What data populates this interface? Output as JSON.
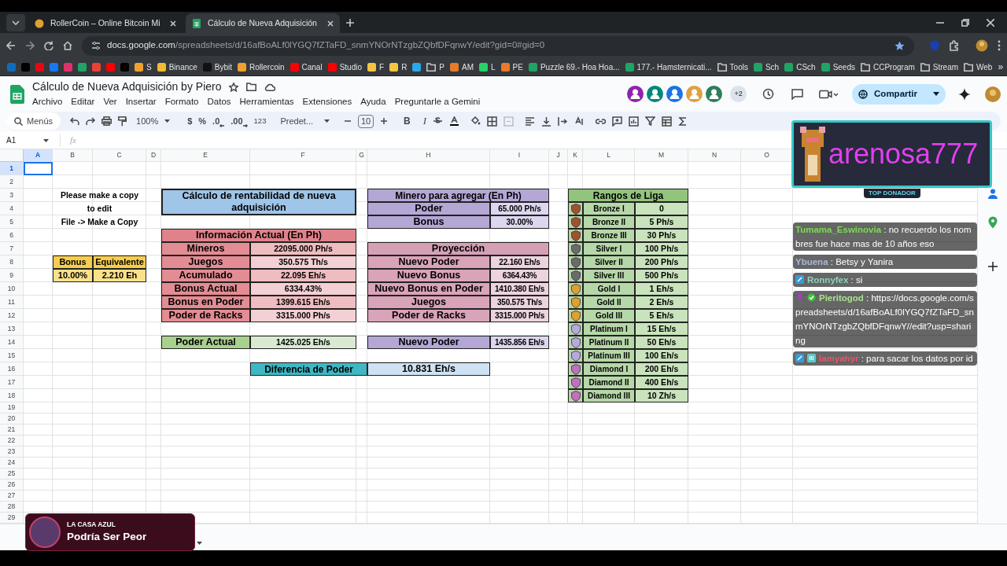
{
  "browser": {
    "tabs": [
      {
        "title": "RollerCoin – Online Bitcoin Mi",
        "selected": false
      },
      {
        "title": "Cálculo de Nueva Adquisición",
        "selected": true
      }
    ],
    "url_host": "docs.google.com",
    "url_path": "/spreadsheets/d/16afBoALf0lYGQ7fZTaFD_snmYNOrNTzgbZQbfDFqnwY/edit?gid=0#gid=0",
    "bookmarks": [
      {
        "kind": "site",
        "color": "#0f6cbd"
      },
      {
        "kind": "site",
        "color": "#000000"
      },
      {
        "kind": "site",
        "color": "#e50914"
      },
      {
        "kind": "site",
        "color": "#1877f2"
      },
      {
        "kind": "site",
        "color": "#e1306c"
      },
      {
        "kind": "site",
        "color": "#1fa463"
      },
      {
        "kind": "site",
        "color": "#ea4335"
      },
      {
        "kind": "site",
        "color": "#ff0000"
      },
      {
        "kind": "site",
        "color": "#000000"
      },
      {
        "kind": "site",
        "color": "#f0a030",
        "label": "S"
      },
      {
        "kind": "site",
        "color": "#f3ba2f",
        "label": "Binance"
      },
      {
        "kind": "site",
        "color": "#111111",
        "label": "Bybit"
      },
      {
        "kind": "site",
        "color": "#f0a030",
        "label": "Rollercoin"
      },
      {
        "kind": "site",
        "color": "#ff0000",
        "label": "Canal"
      },
      {
        "kind": "site",
        "color": "#ff0000",
        "label": "Studio"
      },
      {
        "kind": "site",
        "color": "#f5c542",
        "label": "F"
      },
      {
        "kind": "site",
        "color": "#f5c542",
        "label": "R"
      },
      {
        "kind": "site",
        "color": "#29a9eb"
      },
      {
        "kind": "folder",
        "label": "P"
      },
      {
        "kind": "site",
        "color": "#e87a2a",
        "label": "AM"
      },
      {
        "kind": "site",
        "color": "#25d366",
        "label": "L"
      },
      {
        "kind": "site",
        "color": "#e87a2a",
        "label": "PE"
      },
      {
        "kind": "site",
        "color": "#1fa463",
        "label": "Puzzle 69.- Hoa Hoa..."
      },
      {
        "kind": "site",
        "color": "#1fa463",
        "label": "177.- Hamsternicati..."
      },
      {
        "kind": "folder",
        "label": "Tools"
      },
      {
        "kind": "site",
        "color": "#1fa463",
        "label": "Sch"
      },
      {
        "kind": "site",
        "color": "#1fa463",
        "label": "CSch"
      },
      {
        "kind": "site",
        "color": "#1fa463",
        "label": "Seeds"
      },
      {
        "kind": "folder",
        "label": "CCProgram"
      },
      {
        "kind": "folder",
        "label": "Stream"
      },
      {
        "kind": "folder",
        "label": "Web"
      }
    ],
    "bookmarks_more": "»"
  },
  "doc": {
    "title": "Cálculo de Nueva Adquisición by Piero",
    "menu": [
      "Archivo",
      "Editar",
      "Ver",
      "Insertar",
      "Formato",
      "Datos",
      "Herramientas",
      "Extensiones",
      "Ayuda",
      "Preguntarle a Gemini"
    ],
    "collaborators": [
      {
        "color": "#8e24aa"
      },
      {
        "color": "#00897b"
      },
      {
        "color": "#1a73e8"
      },
      {
        "color": "#e0a040"
      },
      {
        "color": "#2e7d5b"
      }
    ],
    "collaborators_more": "+2",
    "share": "Compartir"
  },
  "toolbar": {
    "search": "Menús",
    "zoom": "100%",
    "currency": "$",
    "percent": "%",
    "dec_less": ".0",
    "dec_more": ".00",
    "number_format": "123",
    "font": "Predet...",
    "font_size": "10",
    "bold": "B",
    "italic": "I"
  },
  "formula_bar": {
    "name_box": "A1",
    "fx": "fx"
  },
  "sheet": {
    "columns": [
      {
        "label": "A",
        "selected": true
      },
      {
        "label": "B",
        "selected": false
      },
      {
        "label": "C",
        "selected": false
      },
      {
        "label": "D",
        "selected": false
      },
      {
        "label": "E",
        "selected": false
      },
      {
        "label": "F",
        "selected": false
      },
      {
        "label": "G",
        "selected": false
      },
      {
        "label": "H",
        "selected": false
      },
      {
        "label": "I",
        "selected": false
      },
      {
        "label": "J",
        "selected": false
      },
      {
        "label": "K",
        "selected": false
      },
      {
        "label": "L",
        "selected": false
      },
      {
        "label": "M",
        "selected": false
      },
      {
        "label": "N",
        "selected": false
      },
      {
        "label": "O",
        "selected": false
      }
    ],
    "rows": [
      {
        "label": "1",
        "selected": true
      },
      {
        "label": "2",
        "selected": false
      },
      {
        "label": "3",
        "selected": false
      },
      {
        "label": "4",
        "selected": false
      },
      {
        "label": "5",
        "selected": false
      },
      {
        "label": "6",
        "selected": false
      },
      {
        "label": "7",
        "selected": false
      },
      {
        "label": "8",
        "selected": false
      },
      {
        "label": "9",
        "selected": false
      },
      {
        "label": "10",
        "selected": false
      },
      {
        "label": "11",
        "selected": false
      },
      {
        "label": "12",
        "selected": false
      },
      {
        "label": "13",
        "selected": false
      },
      {
        "label": "14",
        "selected": false
      },
      {
        "label": "15",
        "selected": false
      },
      {
        "label": "16",
        "selected": false
      },
      {
        "label": "17",
        "selected": false
      },
      {
        "label": "18",
        "selected": false
      },
      {
        "label": "19",
        "selected": false
      },
      {
        "label": "20",
        "selected": false
      },
      {
        "label": "21",
        "selected": false
      },
      {
        "label": "22",
        "selected": false
      },
      {
        "label": "23",
        "selected": false
      },
      {
        "label": "24",
        "selected": false
      },
      {
        "label": "25",
        "selected": false
      },
      {
        "label": "26",
        "selected": false
      },
      {
        "label": "27",
        "selected": false
      },
      {
        "label": "28",
        "selected": false
      },
      {
        "label": "29",
        "selected": false
      }
    ],
    "note": [
      "Please make a copy",
      "to edit",
      "File -> Make a Copy"
    ],
    "bonus_table": {
      "headers": [
        "Bonus",
        "Equivalente"
      ],
      "values": [
        "10.00%",
        "2.210 Eh"
      ]
    },
    "title_block": "Cálculo de rentabilidad de nueva adquisición",
    "info_actual": {
      "title": "Información Actual (En Ph)",
      "rows": [
        {
          "label": "Mineros",
          "value": "22095.000 Ph/s"
        },
        {
          "label": "Juegos",
          "value": "350.575 Th/s"
        },
        {
          "label": "Acumulado",
          "value": "22.095 Eh/s"
        },
        {
          "label": "Bonus Actual",
          "value": "6334.43%"
        },
        {
          "label": "Bonus en Poder",
          "value": "1399.615 Eh/s"
        },
        {
          "label": "Poder de Racks",
          "value": "3315.000 Ph/s"
        }
      ]
    },
    "poder_actual": {
      "label": "Poder Actual",
      "value": "1425.025 Eh/s"
    },
    "diferencia": {
      "label": "Diferencia de Poder",
      "value": "10.831 Eh/s"
    },
    "minero_agregar": {
      "title": "Minero para agregar (En Ph)",
      "rows": [
        {
          "label": "Poder",
          "value": "65.000 Ph/s"
        },
        {
          "label": "Bonus",
          "value": "30.00%"
        }
      ]
    },
    "proyeccion": {
      "title": "Proyección",
      "rows": [
        {
          "label": "Nuevo Poder",
          "value": "22.160 Eh/s"
        },
        {
          "label": "Nuevo Bonus",
          "value": "6364.43%"
        },
        {
          "label": "Nuevo Bonus en Poder",
          "value": "1410.380 Eh/s"
        },
        {
          "label": "Juegos",
          "value": "350.575 Th/s"
        },
        {
          "label": "Poder de Racks",
          "value": "3315.000 Ph/s"
        }
      ]
    },
    "nuevo_poder": {
      "label": "Nuevo Poder",
      "value": "1435.856 Eh/s"
    },
    "rangos": {
      "title": "Rangos de Liga",
      "ranks": [
        {
          "name": "Bronze I",
          "value": "0",
          "color": "#a0522d"
        },
        {
          "name": "Bronze II",
          "value": "5 Ph/s",
          "color": "#a0522d"
        },
        {
          "name": "Bronze III",
          "value": "30 Ph/s",
          "color": "#a0522d"
        },
        {
          "name": "Silver I",
          "value": "100 Ph/s",
          "color": "#6b6b6b"
        },
        {
          "name": "Silver II",
          "value": "200 Ph/s",
          "color": "#6b6b6b"
        },
        {
          "name": "Silver III",
          "value": "500 Ph/s",
          "color": "#6b6b6b"
        },
        {
          "name": "Gold I",
          "value": "1 Eh/s",
          "color": "#e0a030"
        },
        {
          "name": "Gold II",
          "value": "2 Eh/s",
          "color": "#e0a030"
        },
        {
          "name": "Gold III",
          "value": "5 Eh/s",
          "color": "#e0a030"
        },
        {
          "name": "Platinum I",
          "value": "15 Eh/s",
          "color": "#b8a8e0"
        },
        {
          "name": "Platinum II",
          "value": "50 Eh/s",
          "color": "#b8a8e0"
        },
        {
          "name": "Platinum III",
          "value": "100 Eh/s",
          "color": "#b8a8e0"
        },
        {
          "name": "Diamond I",
          "value": "200 Eh/s",
          "color": "#c070c0"
        },
        {
          "name": "Diamond II",
          "value": "400 Eh/s",
          "color": "#c070c0"
        },
        {
          "name": "Diamond III",
          "value": "10 Zh/s",
          "color": "#c070c0"
        }
      ]
    }
  },
  "donor_banner": {
    "name": "arenosa777",
    "label": "TOP DONADOR"
  },
  "chat": [
    {
      "user": "Tumama_Eswinovia",
      "color": "#7ed957",
      "text": ": no recuerdo los nombres fue hace mas de 10 años eso"
    },
    {
      "user": "Ybuena",
      "color": "#a9b8d8",
      "text": ": Betsy y Yanira"
    },
    {
      "user": "Ronnyfex",
      "color": "#8fd3c0",
      "text": ": si",
      "badges": [
        {
          "kind": "mod"
        }
      ]
    },
    {
      "user": "Pieritogod",
      "color": "#a8e08a",
      "text": ": https://docs.google.com/spreadsheets/d/16afBoALf0lYGQ7fZTaFD_snmYNOrNTzgbZQbfDFqnwY//edit?usp=sharing",
      "badges": [
        {
          "kind": "mic"
        },
        {
          "kind": "verified"
        }
      ]
    },
    {
      "user": "Iamyahyr",
      "color": "#f0506a",
      "text": ": para sacar los datos por id",
      "badges": [
        {
          "kind": "mod"
        },
        {
          "kind": "sub"
        }
      ]
    }
  ],
  "now_playing": {
    "artist": "LA CASA AZUL",
    "title": "Podría Ser Peor"
  }
}
